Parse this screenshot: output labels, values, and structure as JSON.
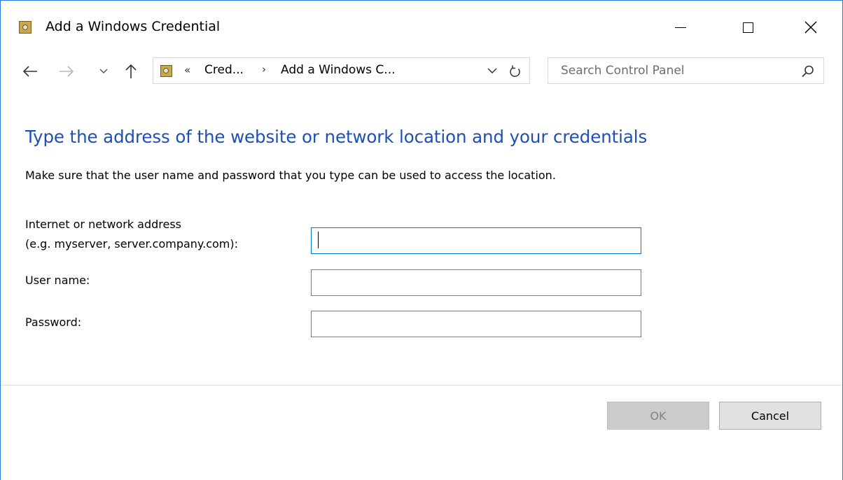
{
  "window": {
    "title": "Add a Windows Credential"
  },
  "navigation": {
    "back_icon": "arrow-left-icon",
    "forward_icon": "arrow-right-icon",
    "recent_icon": "chevron-down-icon",
    "up_icon": "arrow-up-icon"
  },
  "address_bar": {
    "overflow_chevron": "«",
    "crumbs": [
      "Cred...",
      "Add a Windows C..."
    ],
    "separator": "›"
  },
  "search": {
    "placeholder": "Search Control Panel"
  },
  "content": {
    "heading": "Type the address of the website or network location and your credentials",
    "instructions": "Make sure that the user name and password that you type can be used to access the location.",
    "address_label_line1": "Internet or network address",
    "address_label_line2": "(e.g. myserver, server.company.com):",
    "address_value": "",
    "user_label": "User name:",
    "user_value": "",
    "password_label": "Password:",
    "password_value": ""
  },
  "buttons": {
    "ok": "OK",
    "cancel": "Cancel"
  },
  "colors": {
    "heading": "#1e50b3",
    "window_border": "#2b79d7",
    "focus_border": "#0078d7"
  }
}
